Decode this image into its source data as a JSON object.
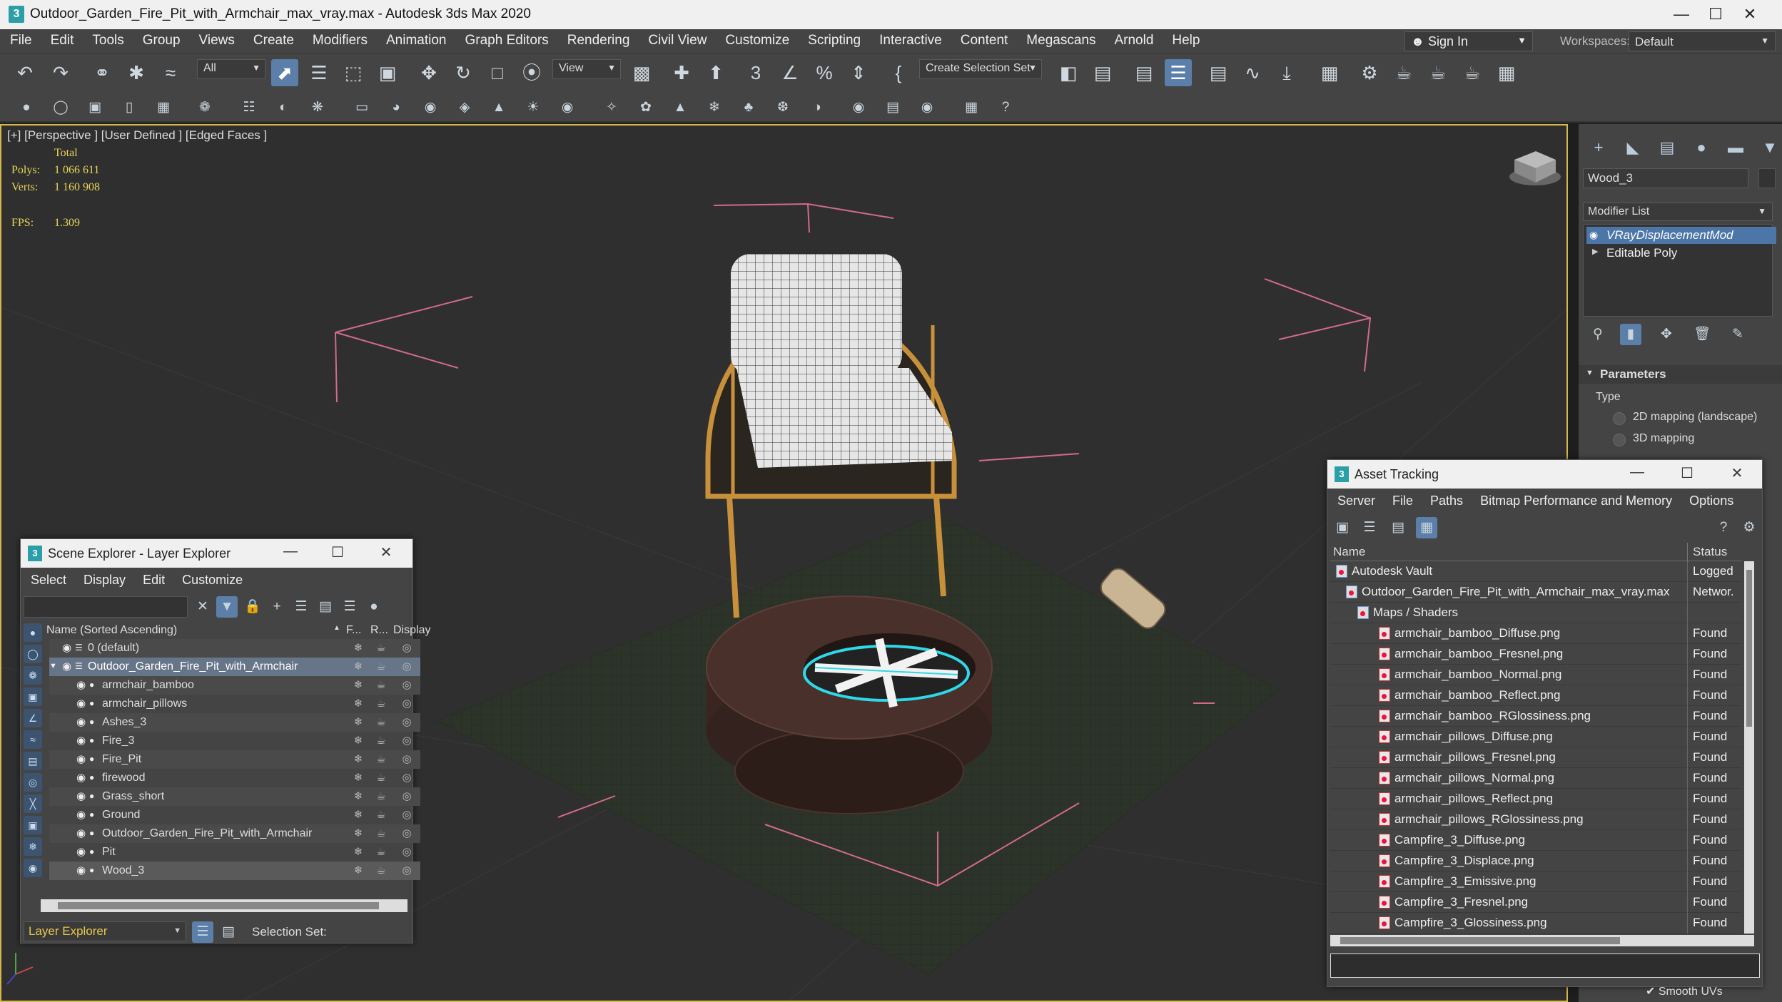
{
  "window": {
    "title": "Outdoor_Garden_Fire_Pit_with_Armchair_max_vray.max - Autodesk 3ds Max 2020",
    "app_icon": "3",
    "min": "—",
    "max": "☐",
    "close": "✕"
  },
  "menu": [
    "File",
    "Edit",
    "Tools",
    "Group",
    "Views",
    "Create",
    "Modifiers",
    "Animation",
    "Graph Editors",
    "Rendering",
    "Civil View",
    "Customize",
    "Scripting",
    "Interactive",
    "Content",
    "Megascans",
    "Arnold",
    "Help"
  ],
  "signin": "Sign In",
  "workspaces": {
    "label": "Workspaces:",
    "value": "Default"
  },
  "toolbar": {
    "filter_value": "All",
    "refcoord_value": "View",
    "selection_set": "Create Selection Set"
  },
  "viewport": {
    "label": "[+] [Perspective ] [User Defined ] [Edged Faces ]",
    "stats_header": "Total",
    "polys_label": "Polys:",
    "polys_value": "1 066 611",
    "verts_label": "Verts:",
    "verts_value": "1 160 908",
    "fps_label": "FPS:",
    "fps_value": "1.309"
  },
  "command_panel": {
    "object_name": "Wood_3",
    "modifier_list": "Modifier List",
    "stack": [
      "VRayDisplacementMod",
      "Editable Poly"
    ],
    "parameters_title": "Parameters",
    "type_label": "Type",
    "type_options": [
      "2D mapping (landscape)",
      "3D mapping"
    ]
  },
  "scene_explorer": {
    "title": "Scene Explorer - Layer Explorer",
    "menu": [
      "Select",
      "Display",
      "Edit",
      "Customize"
    ],
    "col_name": "Name (Sorted Ascending)",
    "col_f": "F...",
    "col_r": "R...",
    "col_display": "Display",
    "rows": [
      "0 (default)",
      "Outdoor_Garden_Fire_Pit_with_Armchair",
      "armchair_bamboo",
      "armchair_pillows",
      "Ashes_3",
      "Fire_3",
      "Fire_Pit",
      "firewood",
      "Grass_short",
      "Ground",
      "Outdoor_Garden_Fire_Pit_with_Armchair",
      "Pit",
      "Wood_3"
    ],
    "footer_mode": "Layer Explorer",
    "footer_selset": "Selection Set:"
  },
  "asset_tracking": {
    "title": "Asset Tracking",
    "menu": [
      "Server",
      "File",
      "Paths",
      "Bitmap Performance and Memory",
      "Options"
    ],
    "col_name": "Name",
    "col_status": "Status",
    "rows": [
      {
        "name": "Autodesk Vault",
        "status": "Logged"
      },
      {
        "name": "Outdoor_Garden_Fire_Pit_with_Armchair_max_vray.max",
        "status": "Networ."
      },
      {
        "name": "Maps / Shaders",
        "status": ""
      },
      {
        "name": "armchair_bamboo_Diffuse.png",
        "status": "Found"
      },
      {
        "name": "armchair_bamboo_Fresnel.png",
        "status": "Found"
      },
      {
        "name": "armchair_bamboo_Normal.png",
        "status": "Found"
      },
      {
        "name": "armchair_bamboo_Reflect.png",
        "status": "Found"
      },
      {
        "name": "armchair_bamboo_RGlossiness.png",
        "status": "Found"
      },
      {
        "name": "armchair_pillows_Diffuse.png",
        "status": "Found"
      },
      {
        "name": "armchair_pillows_Fresnel.png",
        "status": "Found"
      },
      {
        "name": "armchair_pillows_Normal.png",
        "status": "Found"
      },
      {
        "name": "armchair_pillows_Reflect.png",
        "status": "Found"
      },
      {
        "name": "armchair_pillows_RGlossiness.png",
        "status": "Found"
      },
      {
        "name": "Campfire_3_Diffuse.png",
        "status": "Found"
      },
      {
        "name": "Campfire_3_Displace.png",
        "status": "Found"
      },
      {
        "name": "Campfire_3_Emissive.png",
        "status": "Found"
      },
      {
        "name": "Campfire_3_Fresnel.png",
        "status": "Found"
      },
      {
        "name": "Campfire_3_Glossiness.png",
        "status": "Found"
      }
    ],
    "smooth_uvs": "Smooth UVs"
  }
}
